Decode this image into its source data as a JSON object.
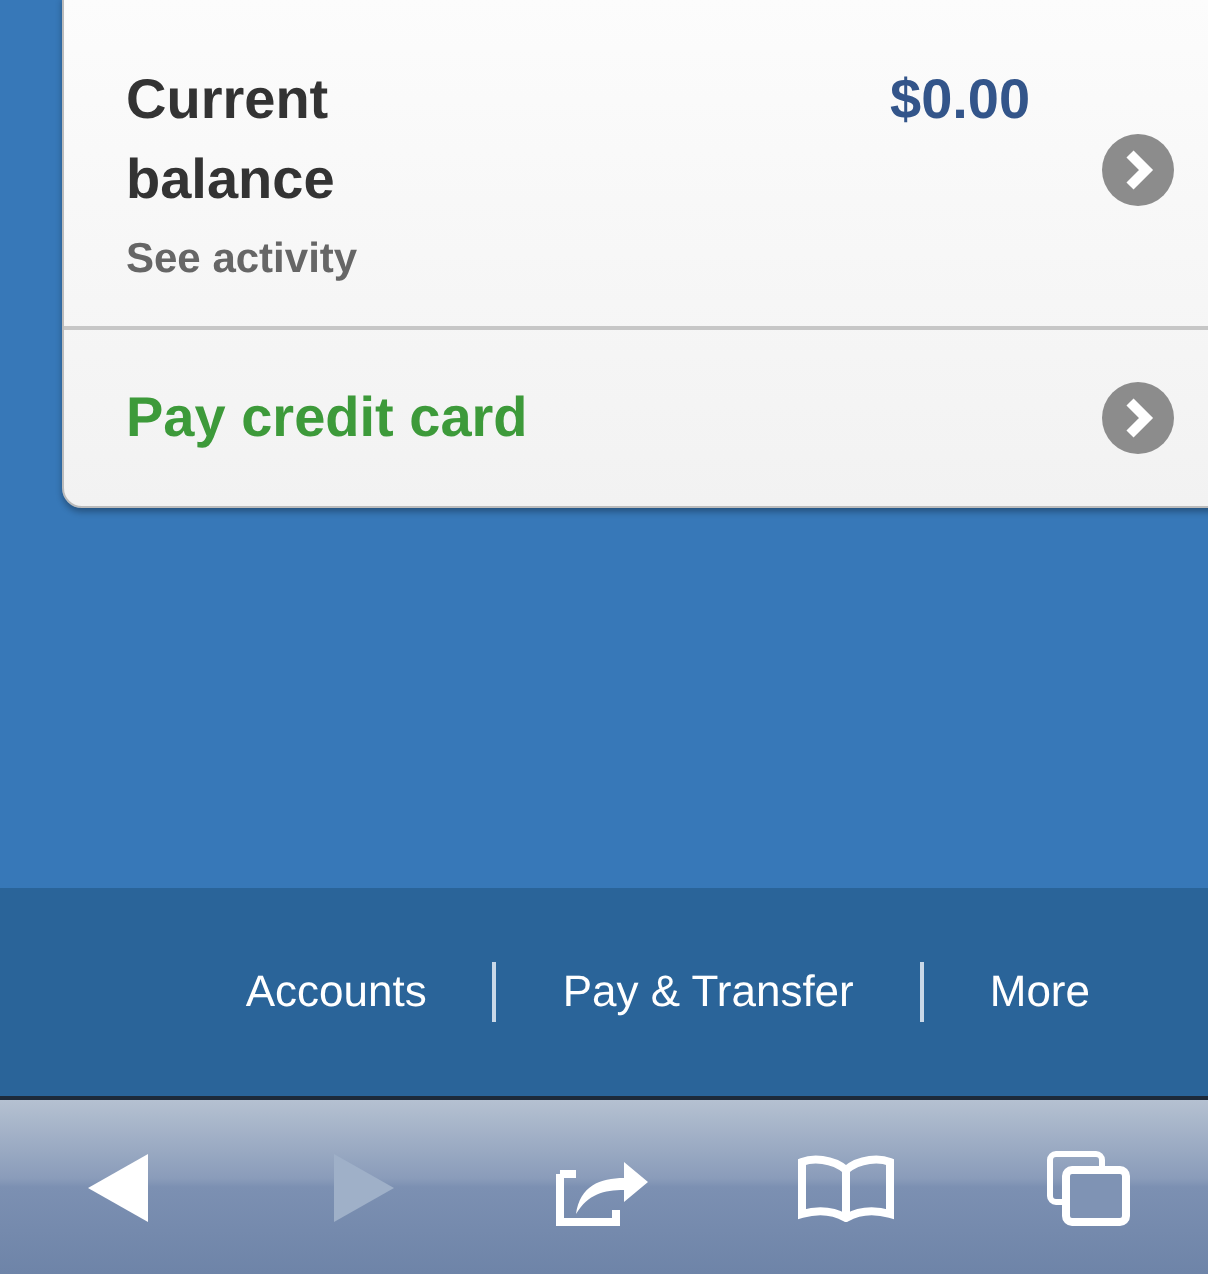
{
  "card": {
    "rows": [
      {
        "kind": "balance",
        "title": "Current balance",
        "amount": "$0.00",
        "subtitle": "See activity"
      },
      {
        "kind": "action",
        "title": "Pay credit card"
      }
    ]
  },
  "footer_nav": {
    "items": [
      "Accounts",
      "Pay & Transfer",
      "More"
    ]
  },
  "browser_toolbar": {
    "buttons": [
      {
        "kind": "back",
        "disabled": false
      },
      {
        "kind": "forward",
        "disabled": true
      },
      {
        "kind": "share",
        "disabled": false
      },
      {
        "kind": "bookmarks",
        "disabled": false
      },
      {
        "kind": "tabs",
        "disabled": false
      }
    ]
  }
}
